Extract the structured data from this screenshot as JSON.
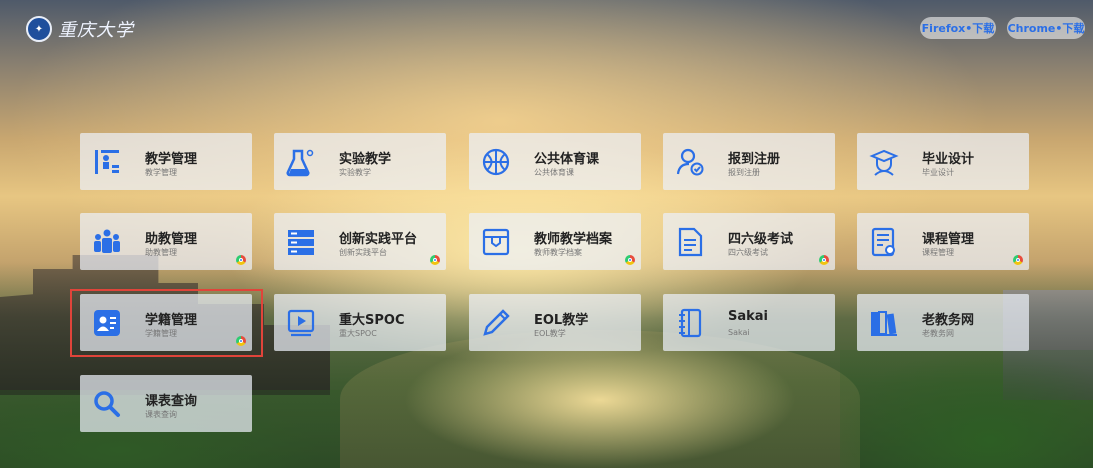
{
  "header": {
    "logo_text": "重庆大学",
    "firefox_label": "Firefox•下载",
    "chrome_label": "Chrome•下载"
  },
  "tiles": [
    {
      "title": "教学管理",
      "sub": "教学管理",
      "icon": "classroom-icon",
      "chrome": false
    },
    {
      "title": "实验教学",
      "sub": "实验教学",
      "icon": "flask-icon",
      "chrome": false
    },
    {
      "title": "公共体育课",
      "sub": "公共体育课",
      "icon": "basketball-icon",
      "chrome": false
    },
    {
      "title": "报到注册",
      "sub": "报到注册",
      "icon": "user-check-icon",
      "chrome": false
    },
    {
      "title": "毕业设计",
      "sub": "毕业设计",
      "icon": "graduation-cap-icon",
      "chrome": false
    },
    {
      "title": "助教管理",
      "sub": "助教管理",
      "icon": "group-icon",
      "chrome": true
    },
    {
      "title": "创新实践平台",
      "sub": "创新实践平台",
      "icon": "server-stack-icon",
      "chrome": true
    },
    {
      "title": "教师教学档案",
      "sub": "教师教学档案",
      "icon": "archive-box-icon",
      "chrome": true
    },
    {
      "title": "四六级考试",
      "sub": "四六级考试",
      "icon": "document-icon",
      "chrome": true
    },
    {
      "title": "课程管理",
      "sub": "课程管理",
      "icon": "document-gear-icon",
      "chrome": true
    },
    {
      "title": "学籍管理",
      "sub": "学籍管理",
      "icon": "student-card-icon",
      "chrome": true
    },
    {
      "title": "重大SPOC",
      "sub": "重大SPOC",
      "icon": "video-play-icon",
      "chrome": false
    },
    {
      "title": "EOL教学",
      "sub": "EOL教学",
      "icon": "pen-icon",
      "chrome": false
    },
    {
      "title": "Sakai",
      "sub": "Sakai",
      "icon": "notebook-icon",
      "chrome": false
    },
    {
      "title": "老教务网",
      "sub": "老教务网",
      "icon": "books-icon",
      "chrome": false
    },
    {
      "title": "课表查询",
      "sub": "课表查询",
      "icon": "search-icon",
      "chrome": false
    }
  ],
  "colors": {
    "accent": "#2b6fe6",
    "highlight_border": "#e0443a"
  }
}
